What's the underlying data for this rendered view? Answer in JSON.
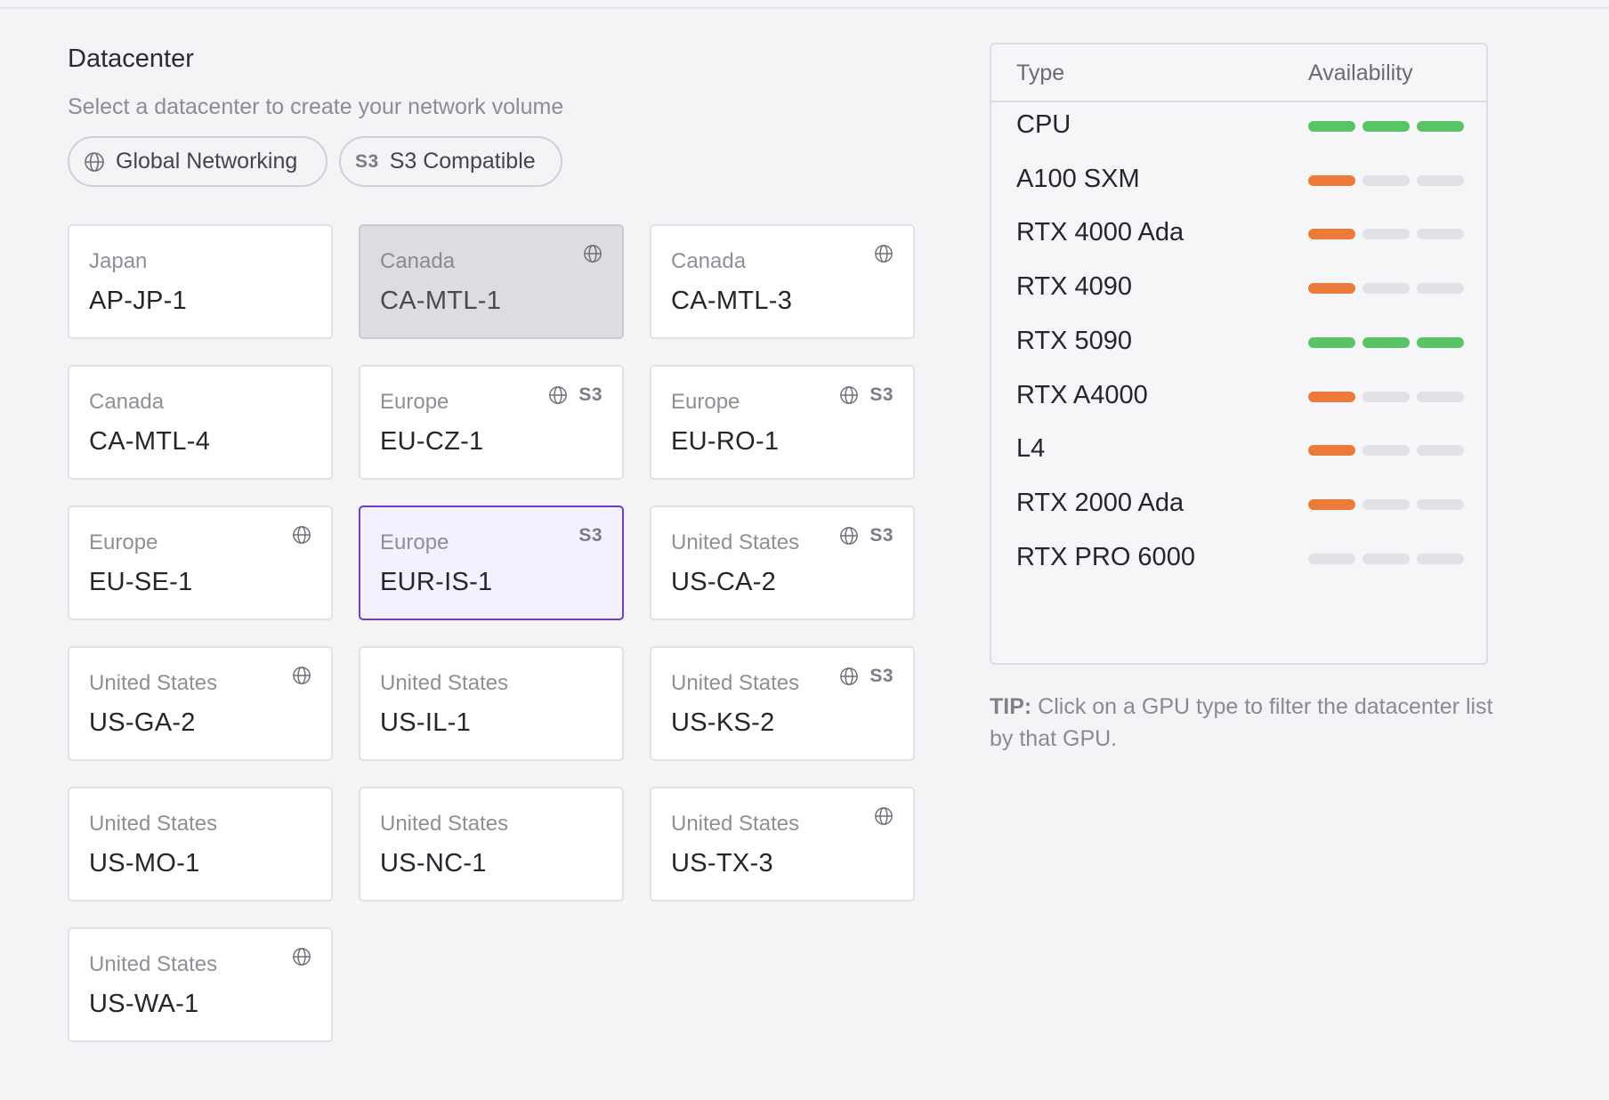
{
  "section": {
    "title": "Datacenter",
    "subtitle": "Select a datacenter to create your network volume"
  },
  "filters": [
    {
      "label": "Global Networking",
      "icon": "globe-icon"
    },
    {
      "label": "S3 Compatible",
      "icon": "s3-icon",
      "glyph": "S3"
    }
  ],
  "datacenters": [
    {
      "region": "Japan",
      "code": "AP-JP-1",
      "global": false,
      "s3": false,
      "state": "normal"
    },
    {
      "region": "Canada",
      "code": "CA-MTL-1",
      "global": true,
      "s3": false,
      "state": "disabled"
    },
    {
      "region": "Canada",
      "code": "CA-MTL-3",
      "global": true,
      "s3": false,
      "state": "normal"
    },
    {
      "region": "Canada",
      "code": "CA-MTL-4",
      "global": false,
      "s3": false,
      "state": "normal"
    },
    {
      "region": "Europe",
      "code": "EU-CZ-1",
      "global": true,
      "s3": true,
      "state": "normal"
    },
    {
      "region": "Europe",
      "code": "EU-RO-1",
      "global": true,
      "s3": true,
      "state": "normal"
    },
    {
      "region": "Europe",
      "code": "EU-SE-1",
      "global": true,
      "s3": false,
      "state": "normal"
    },
    {
      "region": "Europe",
      "code": "EUR-IS-1",
      "global": false,
      "s3": true,
      "state": "selected"
    },
    {
      "region": "United States",
      "code": "US-CA-2",
      "global": true,
      "s3": true,
      "state": "normal"
    },
    {
      "region": "United States",
      "code": "US-GA-2",
      "global": true,
      "s3": false,
      "state": "normal"
    },
    {
      "region": "United States",
      "code": "US-IL-1",
      "global": false,
      "s3": false,
      "state": "normal"
    },
    {
      "region": "United States",
      "code": "US-KS-2",
      "global": true,
      "s3": true,
      "state": "normal"
    },
    {
      "region": "United States",
      "code": "US-MO-1",
      "global": false,
      "s3": false,
      "state": "normal"
    },
    {
      "region": "United States",
      "code": "US-NC-1",
      "global": false,
      "s3": false,
      "state": "normal"
    },
    {
      "region": "United States",
      "code": "US-TX-3",
      "global": true,
      "s3": false,
      "state": "normal"
    },
    {
      "region": "United States",
      "code": "US-WA-1",
      "global": true,
      "s3": false,
      "state": "normal"
    }
  ],
  "availability": {
    "header_type": "Type",
    "header_availability": "Availability",
    "rows": [
      {
        "gpu": "CPU",
        "level": 3,
        "color": "#58c466"
      },
      {
        "gpu": "A100 SXM",
        "level": 1,
        "color": "#ec7b3a"
      },
      {
        "gpu": "RTX 4000 Ada",
        "level": 1,
        "color": "#ec7b3a"
      },
      {
        "gpu": "RTX 4090",
        "level": 1,
        "color": "#ec7b3a"
      },
      {
        "gpu": "RTX 5090",
        "level": 3,
        "color": "#58c466"
      },
      {
        "gpu": "RTX A4000",
        "level": 1,
        "color": "#ec7b3a"
      },
      {
        "gpu": "L4",
        "level": 1,
        "color": "#ec7b3a"
      },
      {
        "gpu": "RTX 2000 Ada",
        "level": 1,
        "color": "#ec7b3a"
      },
      {
        "gpu": "RTX PRO 6000",
        "level": 0,
        "color": "#e1e1e6"
      }
    ]
  },
  "tip": {
    "label": "TIP:",
    "text": " Click on a GPU type to filter the datacenter list by that GPU."
  },
  "colors": {
    "accent": "#6a3fd0",
    "high": "#58c466",
    "low": "#ec7b3a",
    "none": "#e1e1e6"
  }
}
